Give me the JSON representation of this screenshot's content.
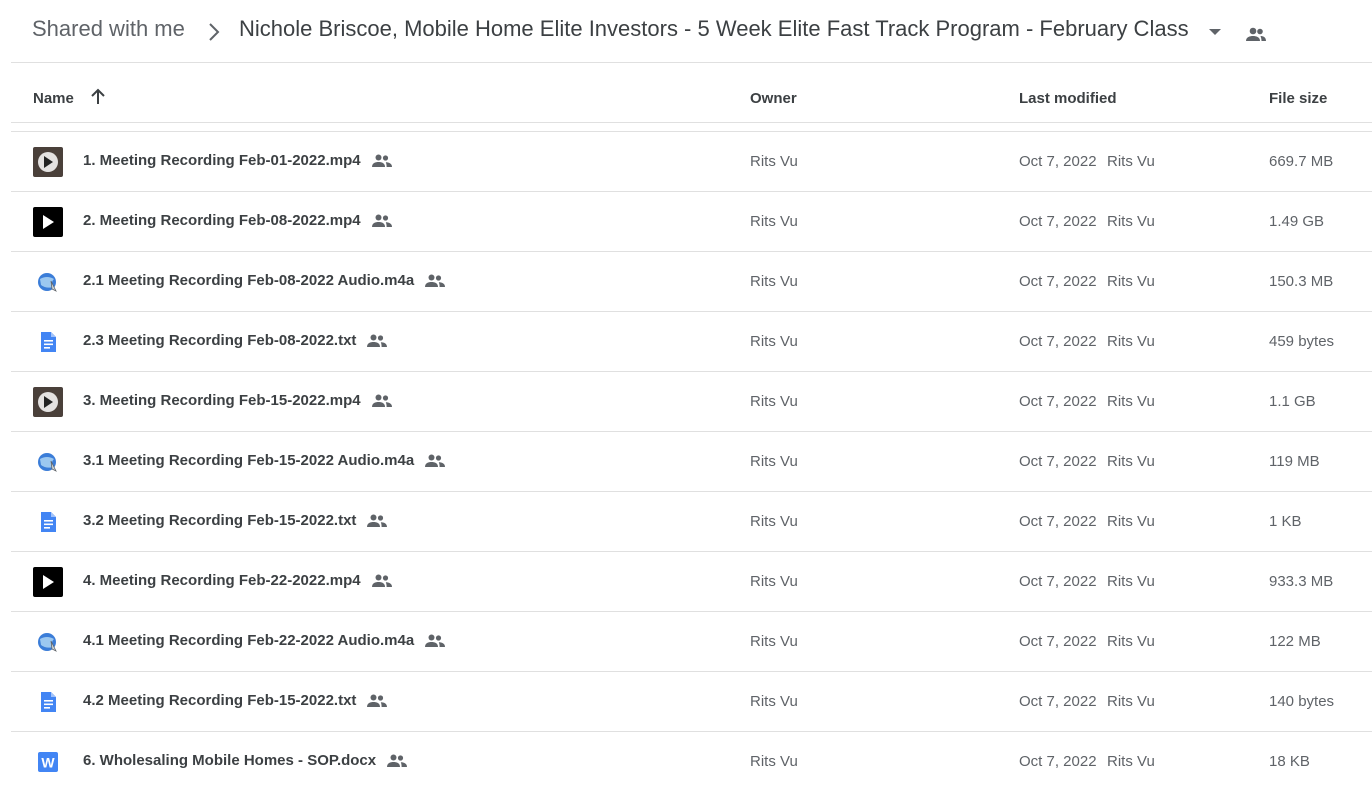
{
  "breadcrumb": {
    "root_label": "Shared with me",
    "separator_icon": "chevron-right-icon",
    "current_label": "Nichole Briscoe, Mobile Home Elite Investors - 5 Week Elite Fast Track Program - February Class",
    "caret_icon": "caret-down-icon",
    "shared_icon": "people-icon"
  },
  "table": {
    "headers": {
      "name": "Name",
      "owner": "Owner",
      "last_modified": "Last modified",
      "file_size": "File size"
    },
    "sort": {
      "column": "Name",
      "direction": "ascending",
      "icon": "arrow-up-icon"
    },
    "rows": [
      {
        "icon": "video-photo-thumb-icon",
        "name": "1. Meeting Recording Feb-01-2022.mp4",
        "owner": "Rits Vu",
        "modified_date": "Oct 7, 2022",
        "modified_by": "Rits Vu",
        "size": "669.7 MB"
      },
      {
        "icon": "video-black-thumb-icon",
        "name": "2. Meeting Recording Feb-08-2022.mp4",
        "owner": "Rits Vu",
        "modified_date": "Oct 7, 2022",
        "modified_by": "Rits Vu",
        "size": "1.49 GB"
      },
      {
        "icon": "audio-file-icon",
        "name": "2.1 Meeting Recording Feb-08-2022 Audio.m4a",
        "owner": "Rits Vu",
        "modified_date": "Oct 7, 2022",
        "modified_by": "Rits Vu",
        "size": "150.3 MB"
      },
      {
        "icon": "text-document-icon",
        "name": "2.3 Meeting Recording Feb-08-2022.txt",
        "owner": "Rits Vu",
        "modified_date": "Oct 7, 2022",
        "modified_by": "Rits Vu",
        "size": "459 bytes"
      },
      {
        "icon": "video-photo-thumb-icon",
        "name": "3. Meeting Recording Feb-15-2022.mp4",
        "owner": "Rits Vu",
        "modified_date": "Oct 7, 2022",
        "modified_by": "Rits Vu",
        "size": "1.1 GB"
      },
      {
        "icon": "audio-file-icon",
        "name": "3.1 Meeting Recording Feb-15-2022 Audio.m4a",
        "owner": "Rits Vu",
        "modified_date": "Oct 7, 2022",
        "modified_by": "Rits Vu",
        "size": "119 MB"
      },
      {
        "icon": "text-document-icon",
        "name": "3.2 Meeting Recording Feb-15-2022.txt",
        "owner": "Rits Vu",
        "modified_date": "Oct 7, 2022",
        "modified_by": "Rits Vu",
        "size": "1 KB"
      },
      {
        "icon": "video-black-thumb-icon",
        "name": "4. Meeting Recording Feb-22-2022.mp4",
        "owner": "Rits Vu",
        "modified_date": "Oct 7, 2022",
        "modified_by": "Rits Vu",
        "size": "933.3 MB"
      },
      {
        "icon": "audio-file-icon",
        "name": "4.1 Meeting Recording Feb-22-2022 Audio.m4a",
        "owner": "Rits Vu",
        "modified_date": "Oct 7, 2022",
        "modified_by": "Rits Vu",
        "size": "122 MB"
      },
      {
        "icon": "text-document-icon",
        "name": "4.2 Meeting Recording Feb-15-2022.txt",
        "owner": "Rits Vu",
        "modified_date": "Oct 7, 2022",
        "modified_by": "Rits Vu",
        "size": "140 bytes"
      },
      {
        "icon": "word-document-icon",
        "name": "6. Wholesaling Mobile Homes - SOP.docx",
        "owner": "Rits Vu",
        "modified_date": "Oct 7, 2022",
        "modified_by": "Rits Vu",
        "size": "18 KB"
      }
    ]
  },
  "colors": {
    "doc_blue": "#4285f4",
    "text_primary": "#3c4043",
    "text_secondary": "#5f6368",
    "divider": "#e0e0e0"
  }
}
